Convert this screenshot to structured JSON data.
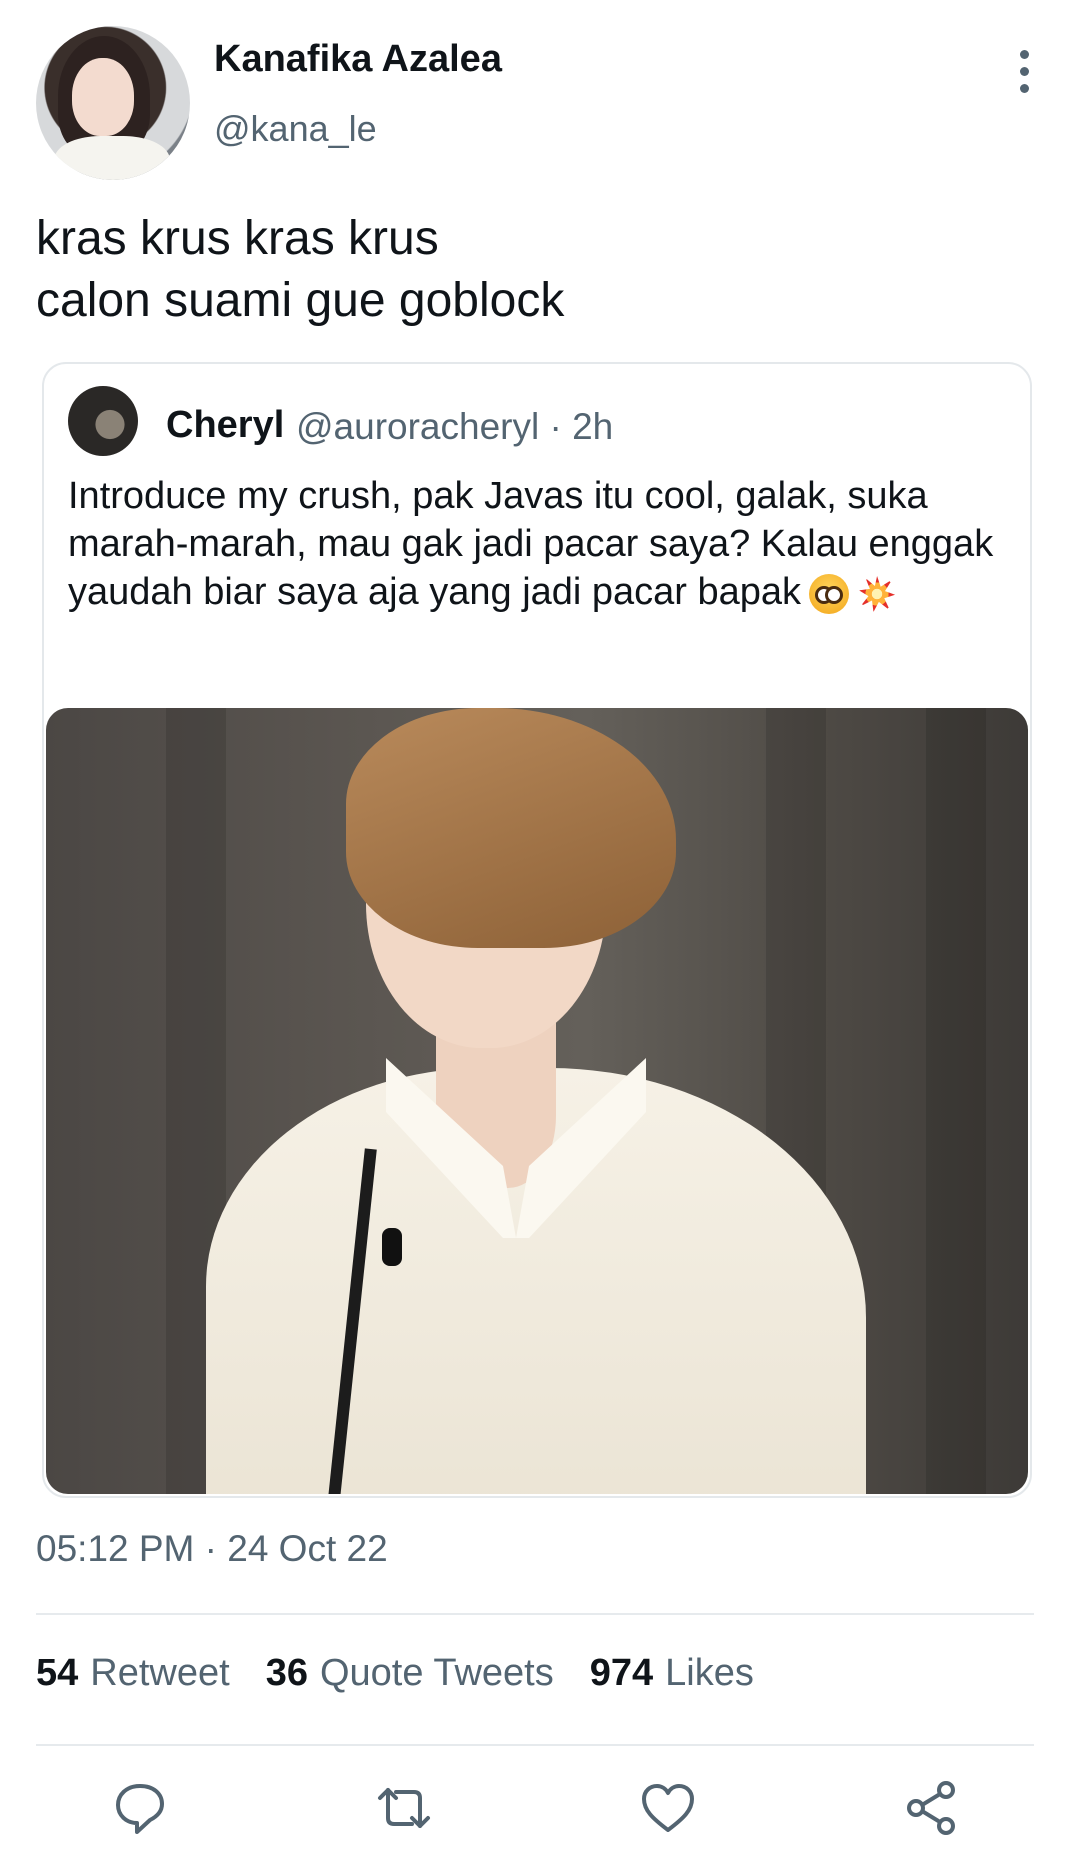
{
  "author": {
    "name": "Kanafika Azalea",
    "handle": "@kana_le"
  },
  "tweet": {
    "text": "kras krus kras krus\ncalon suami gue goblock"
  },
  "quoted": {
    "name": "Cheryl",
    "handle_time": "@auroracheryl · 2h",
    "text": "Introduce my crush, pak Javas itu cool, galak, suka marah-marah, mau gak jadi pacar saya? Kalau enggak yaudah biar saya aja yang jadi pacar bapak",
    "emojis": [
      "pleading-face",
      "collision"
    ]
  },
  "meta": {
    "timestamp": "05:12 PM · 24 Oct 22"
  },
  "stats": {
    "retweets_count": "54",
    "retweets_label": "Retweet",
    "quotes_count": "36",
    "quotes_label": "Quote Tweets",
    "likes_count": "974",
    "likes_label": "Likes"
  },
  "actions": [
    "reply-icon",
    "retweet-icon",
    "like-icon",
    "share-icon"
  ],
  "colors": {
    "text": "#0f1419",
    "muted": "#536471",
    "border": "#e4e8eb"
  }
}
